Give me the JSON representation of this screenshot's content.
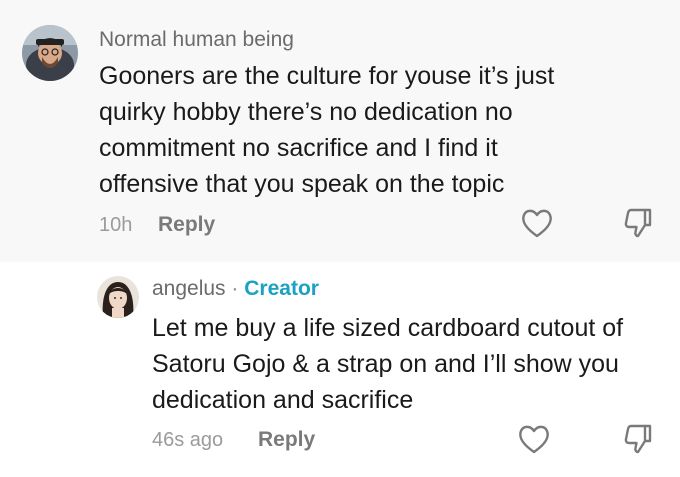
{
  "comments": [
    {
      "username": "Normal human being",
      "text": "Gooners are the culture for youse it’s just quirky hobby there’s no dedication no commitment no sacrifice and I find it offensive that you speak on the topic",
      "time": "10h",
      "reply_label": "Reply",
      "like_icon": "heart-icon",
      "dislike_icon": "thumbs-down-icon"
    },
    {
      "username": "angelus",
      "separator": "·",
      "badge": "Creator",
      "text": "Let me buy a life sized cardboard cutout of Satoru Gojo & a strap on and I’ll show you dedication and sacrifice",
      "time": "46s ago",
      "reply_label": "Reply",
      "like_icon": "heart-icon",
      "dislike_icon": "thumbs-down-icon"
    }
  ],
  "colors": {
    "creator_badge": "#1ba1c4",
    "top_comment_bg": "#f8f8f8"
  }
}
